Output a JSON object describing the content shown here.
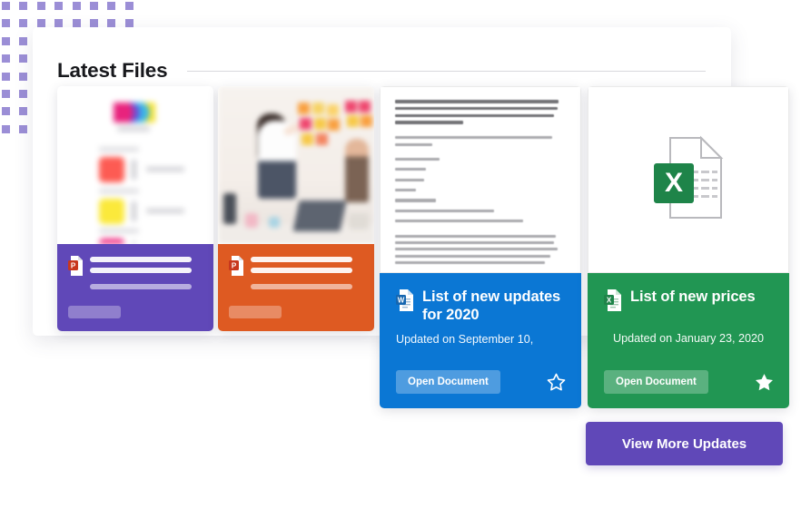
{
  "page": {
    "title": "Latest Files",
    "background_color": "#ffffff",
    "panel_color": "#ffffff"
  },
  "decor": {
    "dot_grid_color": "#9b8ed6",
    "dot_grid_cols": 8,
    "dot_grid_rows": 8
  },
  "cards": [
    {
      "id": "card-1",
      "state": "loading",
      "accent_color": "#6048b8",
      "file_type": "powerpoint",
      "icon": "powerpoint-file-icon",
      "thumbnail": "color-palette-document-preview",
      "title": "",
      "subtitle": "",
      "action_label": ""
    },
    {
      "id": "card-2",
      "state": "loading",
      "accent_color": "#de5a22",
      "file_type": "powerpoint",
      "icon": "powerpoint-file-icon",
      "thumbnail": "office-whiteboard-photo-preview",
      "title": "",
      "subtitle": "",
      "action_label": ""
    },
    {
      "id": "card-3",
      "state": "loaded",
      "accent_color": "#0b77d4",
      "file_type": "word",
      "icon": "word-file-icon",
      "thumbnail": "text-document-preview",
      "title": "List of new updates for 2020",
      "subtitle": "Updated on September 10,",
      "action_label": "Open Document",
      "favorite": false,
      "favorite_icon": "star-outline-icon"
    },
    {
      "id": "card-4",
      "state": "loaded",
      "accent_color": "#219653",
      "file_type": "excel",
      "icon": "excel-file-icon",
      "thumbnail": "excel-file-icon-large",
      "title": "List of new prices",
      "subtitle": "Updated on January 23, 2020",
      "action_label": "Open Document",
      "favorite": true,
      "favorite_icon": "star-filled-icon"
    }
  ],
  "footer": {
    "view_more_label": "View More Updates",
    "view_more_color": "#6048b8"
  }
}
